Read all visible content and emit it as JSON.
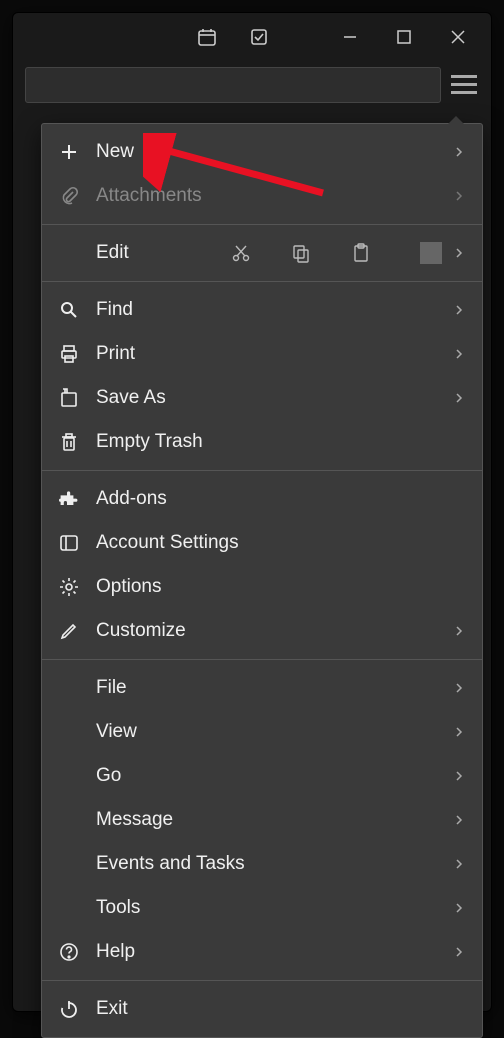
{
  "titlebar": {
    "calendar_icon": "calendar",
    "tasks_icon": "tasks"
  },
  "menu": {
    "new_label": "New",
    "attachments_label": "Attachments",
    "edit_label": "Edit",
    "find_label": "Find",
    "print_label": "Print",
    "saveas_label": "Save As",
    "emptytrash_label": "Empty Trash",
    "addons_label": "Add-ons",
    "accountsettings_label": "Account Settings",
    "options_label": "Options",
    "customize_label": "Customize",
    "file_label": "File",
    "view_label": "View",
    "go_label": "Go",
    "message_label": "Message",
    "eventstasks_label": "Events and Tasks",
    "tools_label": "Tools",
    "help_label": "Help",
    "exit_label": "Exit"
  }
}
